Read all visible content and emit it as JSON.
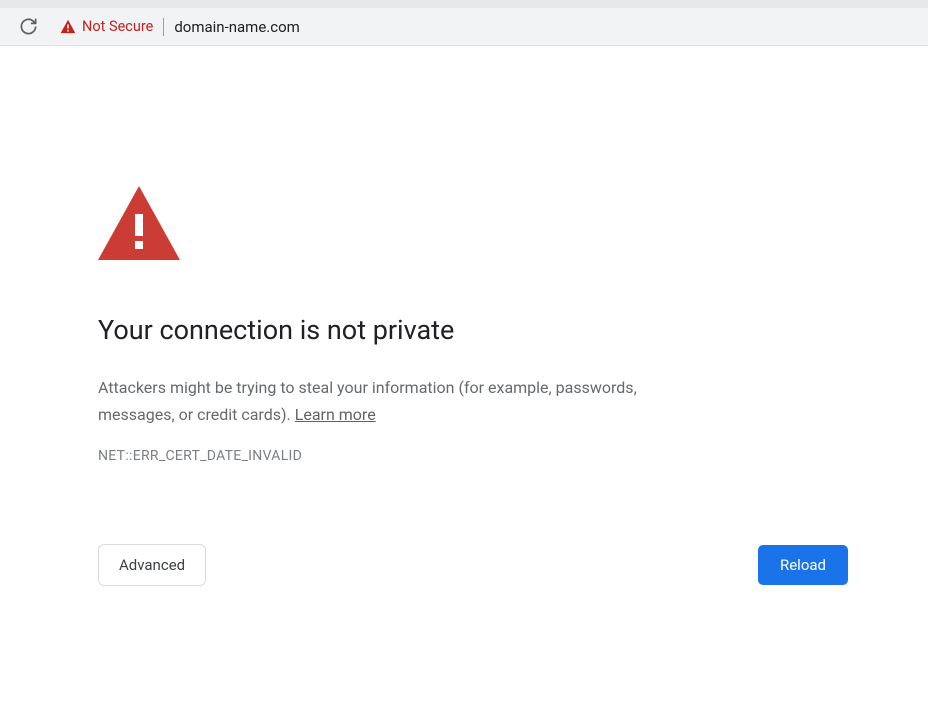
{
  "address_bar": {
    "not_secure_label": "Not Secure",
    "domain": "domain-name.com"
  },
  "page": {
    "title": "Your connection is not private",
    "description_part1": "Attackers might be trying to steal your information (for example, passwords, messages, or credit cards). ",
    "learn_more": "Learn more",
    "error_code": "NET::ERR_CERT_DATE_INVALID",
    "advanced_button": "Advanced",
    "reload_button": "Reload"
  },
  "colors": {
    "warning_red": "#c5221f",
    "triangle_red": "#cb3b36",
    "primary_blue": "#1a73e8"
  }
}
